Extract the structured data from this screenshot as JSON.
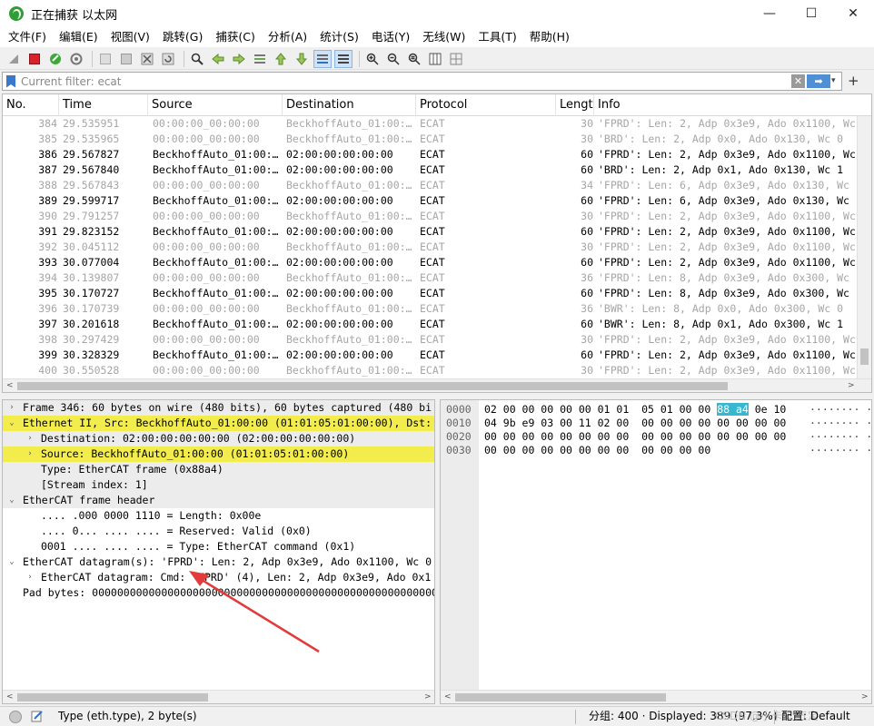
{
  "window": {
    "title": "正在捕获 以太网",
    "minimize": "—",
    "maximize": "☐",
    "close": "✕"
  },
  "menu": [
    "文件(F)",
    "编辑(E)",
    "视图(V)",
    "跳转(G)",
    "捕获(C)",
    "分析(A)",
    "统计(S)",
    "电话(Y)",
    "无线(W)",
    "工具(T)",
    "帮助(H)"
  ],
  "toolbar": {
    "icons": [
      "shark-fin-start-icon",
      "stop-capture-icon",
      "restart-capture-icon",
      "capture-options-icon",
      "open-file-icon",
      "save-file-icon",
      "close-file-icon",
      "reload-icon",
      "find-packet-icon",
      "go-back-icon",
      "go-forward-icon",
      "go-to-packet-icon",
      "go-first-icon",
      "go-last-icon",
      "auto-scroll-icon",
      "colorize-icon",
      "zoom-in-icon",
      "zoom-out-icon",
      "zoom-reset-icon",
      "resize-columns-icon",
      "layout-icon"
    ]
  },
  "filter": {
    "placeholder": "Current filter: ecat",
    "clear": "✕",
    "apply": "➡",
    "dropdown": "▾",
    "add": "+"
  },
  "packet_list": {
    "columns": [
      "No.",
      "Time",
      "Source",
      "Destination",
      "Protocol",
      "Lengt",
      "Info"
    ],
    "rows": [
      {
        "no": "384",
        "time": "29.535951",
        "src": "00:00:00_00:00:00",
        "dst": "BeckhoffAuto_01:00:…",
        "proto": "ECAT",
        "len": "30",
        "info": "'FPRD': Len: 2, Adp 0x3e9, Ado 0x1100, Wc",
        "dim": true
      },
      {
        "no": "385",
        "time": "29.535965",
        "src": "00:00:00_00:00:00",
        "dst": "BeckhoffAuto_01:00:…",
        "proto": "ECAT",
        "len": "30",
        "info": "'BRD': Len: 2, Adp 0x0, Ado 0x130, Wc 0",
        "dim": true
      },
      {
        "no": "386",
        "time": "29.567827",
        "src": "BeckhoffAuto_01:00:…",
        "dst": "02:00:00:00:00:00",
        "proto": "ECAT",
        "len": "60",
        "info": "'FPRD': Len: 2, Adp 0x3e9, Ado 0x1100, Wc",
        "dim": false
      },
      {
        "no": "387",
        "time": "29.567840",
        "src": "BeckhoffAuto_01:00:…",
        "dst": "02:00:00:00:00:00",
        "proto": "ECAT",
        "len": "60",
        "info": "'BRD': Len: 2, Adp 0x1, Ado 0x130, Wc 1",
        "dim": false
      },
      {
        "no": "388",
        "time": "29.567843",
        "src": "00:00:00_00:00:00",
        "dst": "BeckhoffAuto_01:00:…",
        "proto": "ECAT",
        "len": "34",
        "info": "'FPRD': Len: 6, Adp 0x3e9, Ado 0x130, Wc",
        "dim": true
      },
      {
        "no": "389",
        "time": "29.599717",
        "src": "BeckhoffAuto_01:00:…",
        "dst": "02:00:00:00:00:00",
        "proto": "ECAT",
        "len": "60",
        "info": "'FPRD': Len: 6, Adp 0x3e9, Ado 0x130, Wc",
        "dim": false
      },
      {
        "no": "390",
        "time": "29.791257",
        "src": "00:00:00_00:00:00",
        "dst": "BeckhoffAuto_01:00:…",
        "proto": "ECAT",
        "len": "30",
        "info": "'FPRD': Len: 2, Adp 0x3e9, Ado 0x1100, Wc",
        "dim": true
      },
      {
        "no": "391",
        "time": "29.823152",
        "src": "BeckhoffAuto_01:00:…",
        "dst": "02:00:00:00:00:00",
        "proto": "ECAT",
        "len": "60",
        "info": "'FPRD': Len: 2, Adp 0x3e9, Ado 0x1100, Wc",
        "dim": false
      },
      {
        "no": "392",
        "time": "30.045112",
        "src": "00:00:00_00:00:00",
        "dst": "BeckhoffAuto_01:00:…",
        "proto": "ECAT",
        "len": "30",
        "info": "'FPRD': Len: 2, Adp 0x3e9, Ado 0x1100, Wc",
        "dim": true
      },
      {
        "no": "393",
        "time": "30.077004",
        "src": "BeckhoffAuto_01:00:…",
        "dst": "02:00:00:00:00:00",
        "proto": "ECAT",
        "len": "60",
        "info": "'FPRD': Len: 2, Adp 0x3e9, Ado 0x1100, Wc",
        "dim": false
      },
      {
        "no": "394",
        "time": "30.139807",
        "src": "00:00:00_00:00:00",
        "dst": "BeckhoffAuto_01:00:…",
        "proto": "ECAT",
        "len": "36",
        "info": "'FPRD': Len: 8, Adp 0x3e9, Ado 0x300, Wc",
        "dim": true
      },
      {
        "no": "395",
        "time": "30.170727",
        "src": "BeckhoffAuto_01:00:…",
        "dst": "02:00:00:00:00:00",
        "proto": "ECAT",
        "len": "60",
        "info": "'FPRD': Len: 8, Adp 0x3e9, Ado 0x300, Wc",
        "dim": false
      },
      {
        "no": "396",
        "time": "30.170739",
        "src": "00:00:00_00:00:00",
        "dst": "BeckhoffAuto_01:00:…",
        "proto": "ECAT",
        "len": "36",
        "info": "'BWR': Len: 8, Adp 0x0, Ado 0x300, Wc 0",
        "dim": true
      },
      {
        "no": "397",
        "time": "30.201618",
        "src": "BeckhoffAuto_01:00:…",
        "dst": "02:00:00:00:00:00",
        "proto": "ECAT",
        "len": "60",
        "info": "'BWR': Len: 8, Adp 0x1, Ado 0x300, Wc 1",
        "dim": false
      },
      {
        "no": "398",
        "time": "30.297429",
        "src": "00:00:00_00:00:00",
        "dst": "BeckhoffAuto_01:00:…",
        "proto": "ECAT",
        "len": "30",
        "info": "'FPRD': Len: 2, Adp 0x3e9, Ado 0x1100, Wc",
        "dim": true
      },
      {
        "no": "399",
        "time": "30.328329",
        "src": "BeckhoffAuto_01:00:…",
        "dst": "02:00:00:00:00:00",
        "proto": "ECAT",
        "len": "60",
        "info": "'FPRD': Len: 2, Adp 0x3e9, Ado 0x1100, Wc",
        "dim": false
      },
      {
        "no": "400",
        "time": "30.550528",
        "src": "00:00:00_00:00:00",
        "dst": "BeckhoffAuto_01:00:…",
        "proto": "ECAT",
        "len": "30",
        "info": "'FPRD': Len: 2, Adp 0x3e9, Ado 0x1100, Wc",
        "dim": true
      }
    ]
  },
  "details": [
    {
      "text": "Frame 346: 60 bytes on wire (480 bits), 60 bytes captured (480 bi",
      "indent": 0,
      "expander": "›",
      "style": "gray"
    },
    {
      "text": "Ethernet II, Src: BeckhoffAuto_01:00:00 (01:01:05:01:00:00), Dst:",
      "indent": 0,
      "expander": "⌄",
      "style": "hl"
    },
    {
      "text": "Destination: 02:00:00:00:00:00 (02:00:00:00:00:00)",
      "indent": 1,
      "expander": "›",
      "style": "gray"
    },
    {
      "text": "Source: BeckhoffAuto_01:00:00 (01:01:05:01:00:00)",
      "indent": 1,
      "expander": "›",
      "style": "hl"
    },
    {
      "text": "Type: EtherCAT frame (0x88a4)",
      "indent": 1,
      "expander": "",
      "style": "gray"
    },
    {
      "text": "[Stream index: 1]",
      "indent": 1,
      "expander": "",
      "style": "gray"
    },
    {
      "text": "EtherCAT frame header",
      "indent": 0,
      "expander": "⌄",
      "style": "gray"
    },
    {
      "text": ".... .000 0000 1110 = Length: 0x00e",
      "indent": 1,
      "expander": "",
      "style": ""
    },
    {
      "text": ".... 0... .... .... = Reserved: Valid (0x0)",
      "indent": 1,
      "expander": "",
      "style": ""
    },
    {
      "text": "0001 .... .... .... = Type: EtherCAT command (0x1)",
      "indent": 1,
      "expander": "",
      "style": ""
    },
    {
      "text": "EtherCAT datagram(s): 'FPRD': Len: 2, Adp 0x3e9, Ado 0x1100, Wc 0",
      "indent": 0,
      "expander": "⌄",
      "style": ""
    },
    {
      "text": "EtherCAT datagram: Cmd: 'FPRD' (4), Len: 2, Adp 0x3e9, Ado 0x1",
      "indent": 1,
      "expander": "›",
      "style": ""
    },
    {
      "text": "Pad bytes: 0000000000000000000000000000000000000000000000000000000",
      "indent": 0,
      "expander": "",
      "style": ""
    }
  ],
  "bytes": [
    {
      "offset": "0000",
      "hex_a": "02 00 00 00 00 00 01 01  05 01 00 00 ",
      "sel": "88 a4",
      "hex_b": " 0e 10",
      "ascii": "········ ··"
    },
    {
      "offset": "0010",
      "hex_a": "04 9b e9 03 00 11 02 00  00 00 00 00 00 00 00 00",
      "sel": "",
      "hex_b": "",
      "ascii": "········ ········"
    },
    {
      "offset": "0020",
      "hex_a": "00 00 00 00 00 00 00 00  00 00 00 00 00 00 00 00",
      "sel": "",
      "hex_b": "",
      "ascii": "········ ········"
    },
    {
      "offset": "0030",
      "hex_a": "00 00 00 00 00 00 00 00  00 00 00 00",
      "sel": "",
      "hex_b": "",
      "ascii": "········ ····"
    }
  ],
  "status": {
    "left": "Type (eth.type), 2 byte(s)",
    "packets": "分组: 400 · Displayed: 389 (97.3%)",
    "profile": "配置: Default",
    "watermark": "CSDN @小卡车 五定"
  }
}
